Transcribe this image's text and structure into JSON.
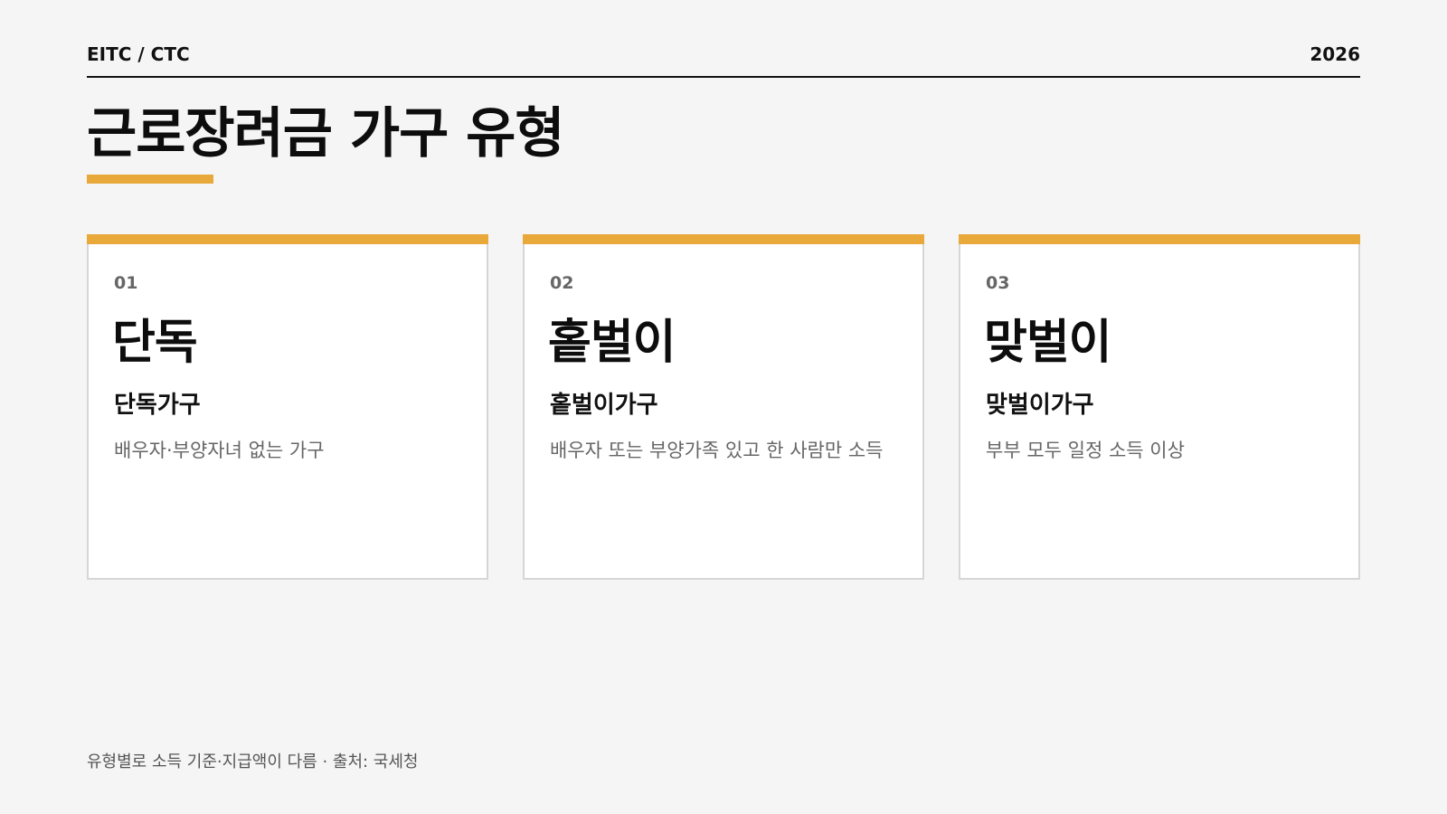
{
  "colors": {
    "background": "#f5f5f5",
    "accent": "#e8a83a",
    "text_primary": "#111111",
    "text_muted": "#666666",
    "card_background": "#ffffff",
    "card_border": "#d6d6d6"
  },
  "header": {
    "left_label": "EITC / CTC",
    "year": "2026"
  },
  "title": "근로장려금 가구 유형",
  "cards": [
    {
      "number": "01",
      "type": "단독",
      "subtitle": "단독가구",
      "description": "배우자·부양자녀 없는 가구"
    },
    {
      "number": "02",
      "type": "홑벌이",
      "subtitle": "홑벌이가구",
      "description": "배우자 또는 부양가족 있고 한 사람만 소득"
    },
    {
      "number": "03",
      "type": "맞벌이",
      "subtitle": "맞벌이가구",
      "description": "부부 모두 일정 소득 이상"
    }
  ],
  "footer": "유형별로 소득 기준·지급액이 다름 · 출처: 국세청"
}
